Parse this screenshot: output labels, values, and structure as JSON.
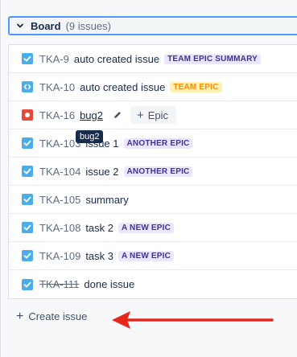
{
  "board": {
    "title": "Board",
    "count": "(9 issues)"
  },
  "issues": [
    {
      "type": "task",
      "key": "TKA-9",
      "summary": "auto created issue",
      "epic": "TEAM EPIC SUMMARY",
      "epic_color": "purple"
    },
    {
      "type": "subtask",
      "key": "TKA-10",
      "summary": "auto created issue",
      "epic": "TEAM EPIC",
      "epic_color": "orange"
    },
    {
      "type": "bug",
      "key": "TKA-16",
      "summary": "bug2",
      "epic_button": "Epic"
    },
    {
      "type": "task",
      "key": "TKA-103",
      "summary": "issue 1",
      "epic": "ANOTHER EPIC",
      "epic_color": "purple"
    },
    {
      "type": "task",
      "key": "TKA-104",
      "summary": "issue 2",
      "epic": "ANOTHER EPIC",
      "epic_color": "purple"
    },
    {
      "type": "task",
      "key": "TKA-105",
      "summary": "summary"
    },
    {
      "type": "task",
      "key": "TKA-108",
      "summary": "task 2",
      "epic": "A NEW EPIC",
      "epic_color": "purple"
    },
    {
      "type": "task",
      "key": "TKA-109",
      "summary": "task 3",
      "epic": "A NEW EPIC",
      "epic_color": "purple"
    },
    {
      "type": "task",
      "key": "TKA-111",
      "summary": "done issue",
      "done": true
    }
  ],
  "tooltip": "bug2",
  "create_issue": "Create issue",
  "colors": {
    "focus_border": "#4c9aff",
    "task_icon": "#4bade8",
    "bug_icon": "#e5493a",
    "lozenge_purple_bg": "#eae6ff",
    "lozenge_purple_text": "#403294",
    "lozenge_orange_bg": "#fff0b3",
    "lozenge_orange_text": "#ff8b00",
    "arrow": "#e5271e"
  }
}
